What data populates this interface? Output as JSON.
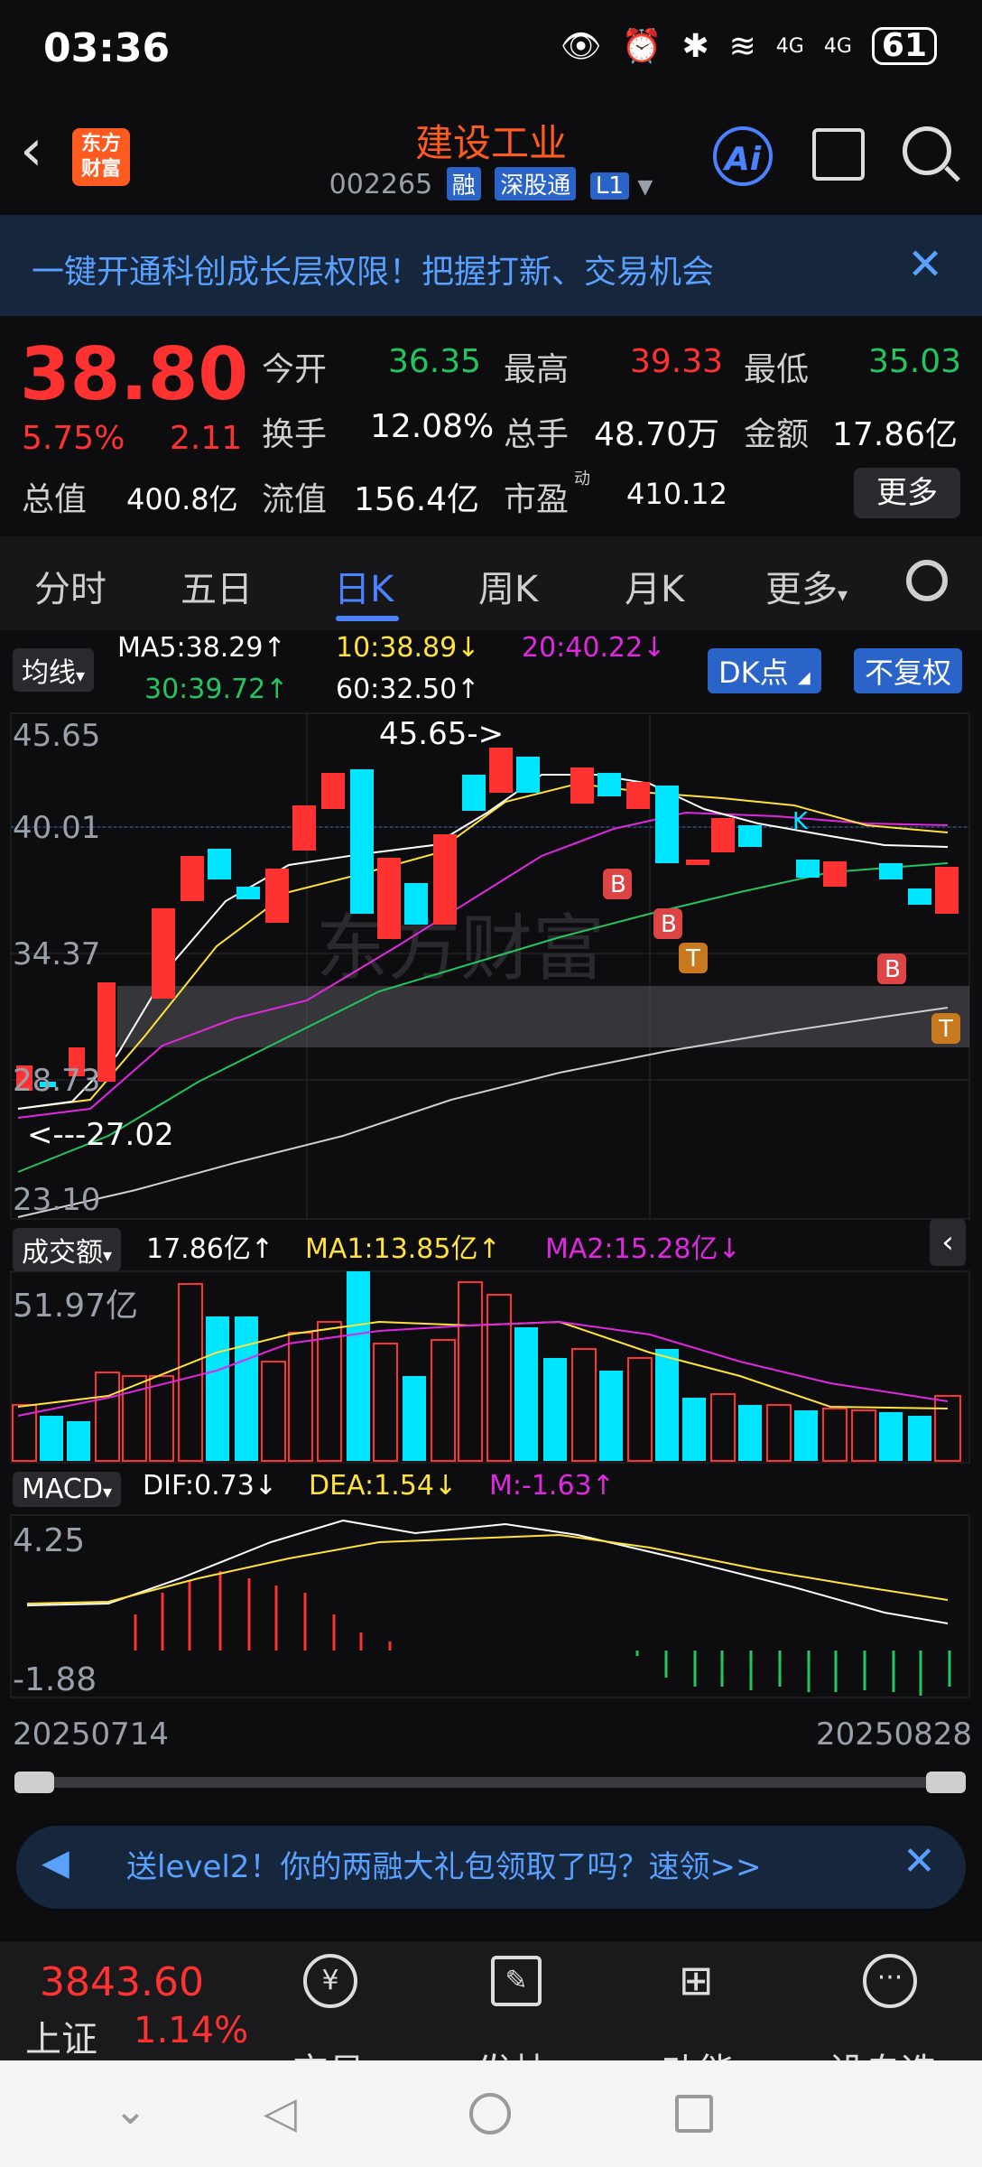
{
  "status": {
    "time": "03:36",
    "battery": "61",
    "net1": "4G",
    "net2": "4G"
  },
  "header": {
    "title": "建设工业",
    "code": "002265",
    "tags": [
      "融",
      "深股通",
      "L1"
    ],
    "logo": "东方\n财富",
    "ai": "Ai"
  },
  "banner": {
    "text": "一键开通科创成长层权限！把握打新、交易机会"
  },
  "quote": {
    "price": "38.80",
    "pct": "5.75%",
    "chg": "2.11",
    "open_label": "今开",
    "open": "36.35",
    "high_label": "最高",
    "high": "39.33",
    "low_label": "最低",
    "low": "35.03",
    "turnover_label": "换手",
    "turnover": "12.08%",
    "vol_label": "总手",
    "vol": "48.70万",
    "amt_label": "金额",
    "amt": "17.86亿",
    "mktcap_label": "总值",
    "mktcap": "400.8亿",
    "float_label": "流值",
    "float": "156.4亿",
    "pe_label": "市盈",
    "pe_sup": "动",
    "pe": "410.12",
    "more": "更多"
  },
  "tabs": [
    "分时",
    "五日",
    "日K",
    "周K",
    "月K",
    "更多"
  ],
  "chart": {
    "selector": "均线",
    "ma5": "MA5:38.29↑",
    "ma10": "10:38.89↓",
    "ma20": "20:40.22↓",
    "ma30": "30:39.72↑",
    "ma60": "60:32.50↑",
    "dk": "DK点",
    "fq": "不复权",
    "max_label": "45.65->",
    "min_label": "<---27.02",
    "axis": [
      "45.65",
      "40.01",
      "34.37",
      "28.73",
      "23.10"
    ],
    "vol_selector": "成交额",
    "vol_val": "17.86亿↑",
    "vol_ma1": "MA1:13.85亿↑",
    "vol_ma2": "MA2:15.28亿↓",
    "vol_axis": "51.97亿",
    "macd_selector": "MACD",
    "dif": "DIF:0.73↓",
    "dea": "DEA:1.54↓",
    "m": "M:-1.63↑",
    "macd_top": "4.25",
    "macd_bottom": "-1.88",
    "date_start": "20250714",
    "date_end": "20250828"
  },
  "chart_data": {
    "type": "candlestick",
    "x": [
      "20250714",
      "...",
      "20250828"
    ],
    "price_range": [
      23.1,
      45.65
    ],
    "high_marker": 45.65,
    "low_marker": 27.02,
    "last_close": 38.8,
    "volume_max_label": "51.97亿",
    "macd_range": [
      -1.88,
      4.25
    ]
  },
  "bottom_banner": {
    "text": "送level2！你的两融大礼包领取了吗？速领>>"
  },
  "bottombar": {
    "index_value": "3843.60",
    "index_name": "上证",
    "index_pct": "1.14%",
    "trade": "交易",
    "post": "发帖",
    "func": "功能",
    "add": "设自选"
  },
  "colors": {
    "up": "#ff3232",
    "down": "#00e5ff",
    "accent": "#4a82ff",
    "brand": "#ff5a1f"
  }
}
